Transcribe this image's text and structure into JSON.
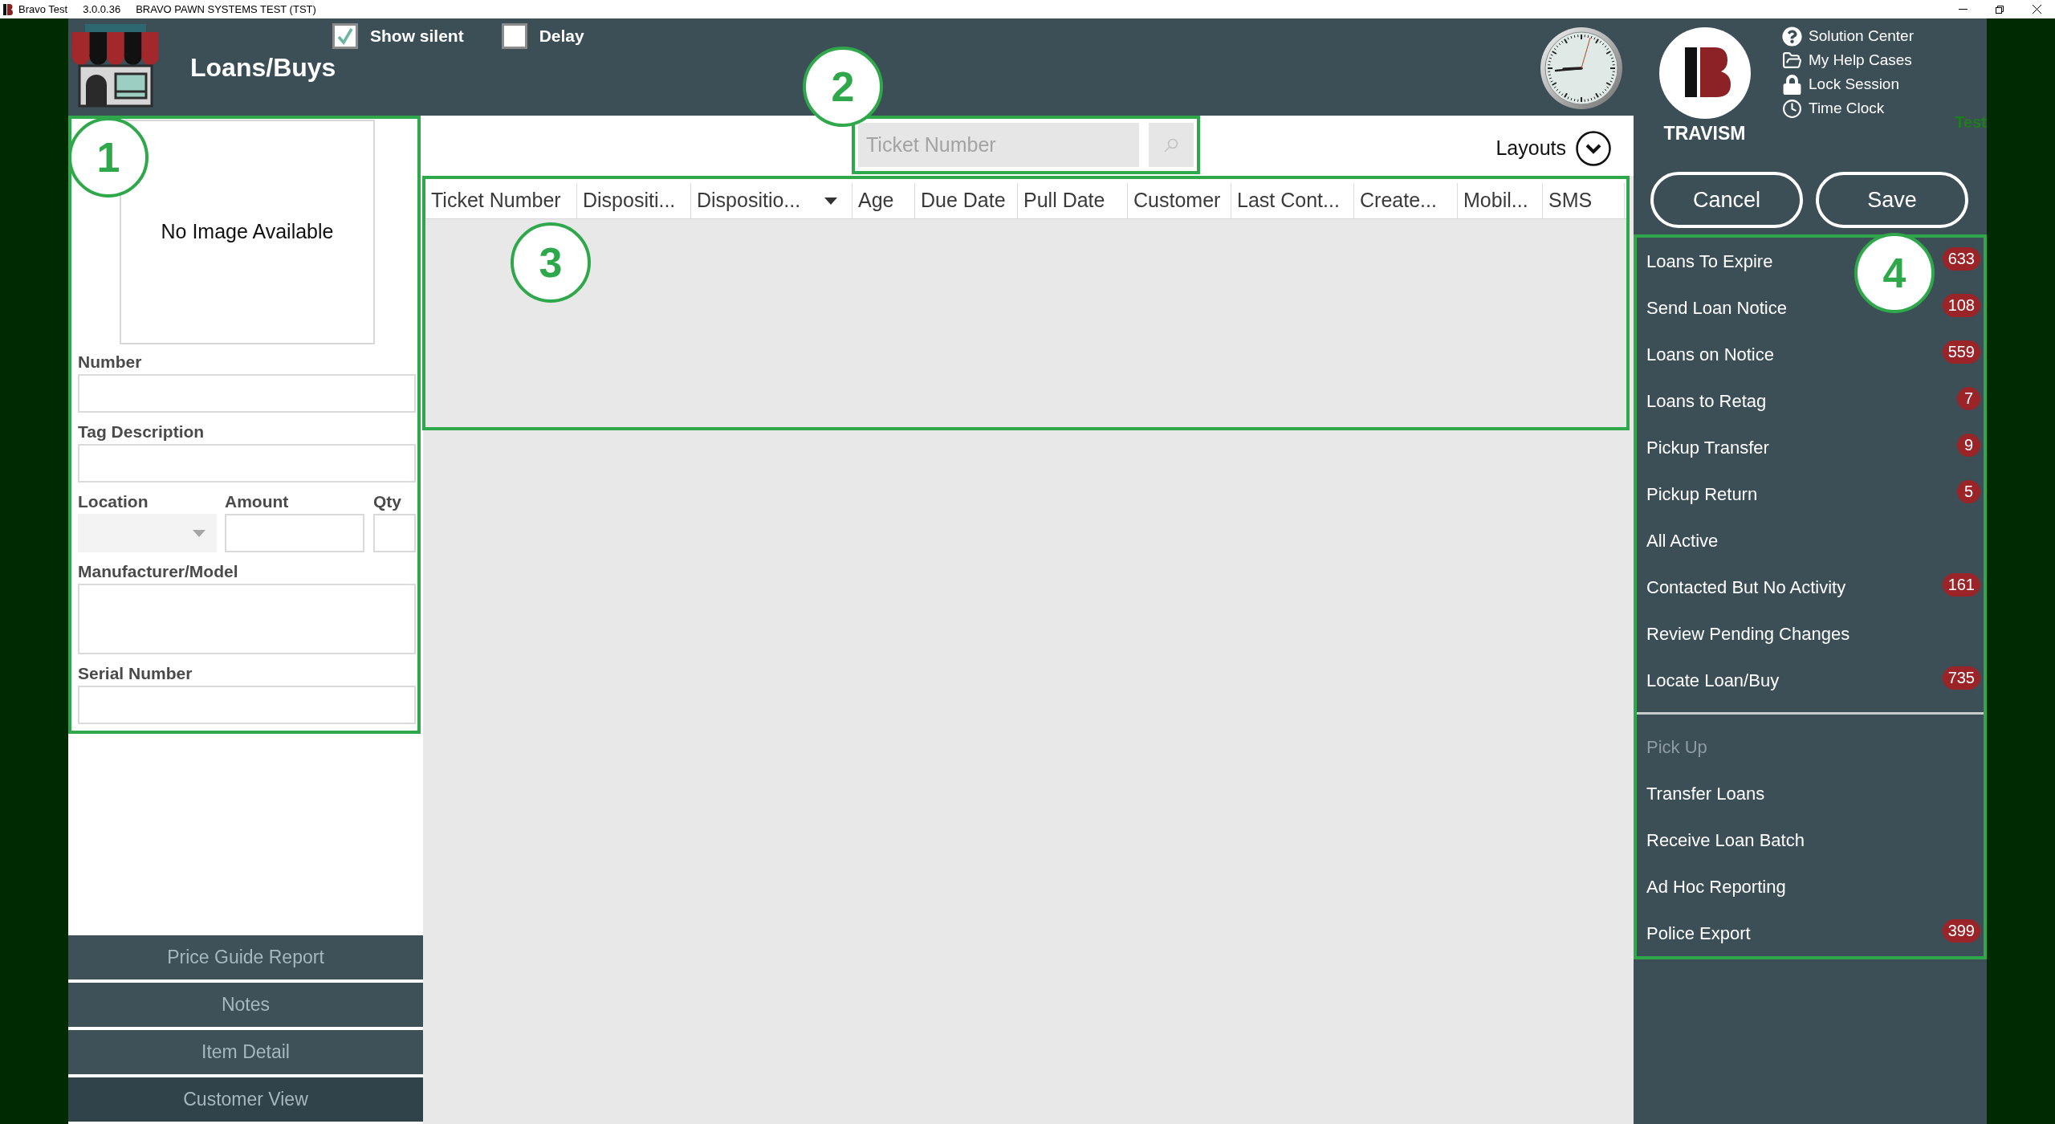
{
  "title_bar": {
    "app_name": "Bravo Test",
    "version": "3.0.0.36",
    "environment": "BRAVO PAWN SYSTEMS TEST (TST)"
  },
  "header": {
    "title": "Loans/Buys",
    "options": [
      {
        "label": "Show silent",
        "checked": true
      },
      {
        "label": "Delay",
        "checked": false
      }
    ]
  },
  "account": {
    "user": "TRAVISM",
    "links": [
      {
        "kind": "help",
        "label": "Solution Center"
      },
      {
        "kind": "folder",
        "label": "My Help Cases"
      },
      {
        "kind": "lock",
        "label": "Lock Session"
      },
      {
        "kind": "clock",
        "label": "Time Clock"
      }
    ],
    "environment_tag": "Test"
  },
  "actions": [
    "Cancel",
    "Save"
  ],
  "details_panel": {
    "callout": "1",
    "image_placeholder": "No Image Available",
    "rows": [
      {
        "fields": [
          {
            "kind": "text",
            "label": "Number"
          }
        ]
      },
      {
        "fields": [
          {
            "kind": "text",
            "label": "Tag Description"
          }
        ]
      },
      {
        "fields": [
          {
            "kind": "dropdown",
            "label": "Location"
          },
          {
            "kind": "text",
            "label": "Amount"
          },
          {
            "kind": "text",
            "label": "Qty"
          }
        ]
      },
      {
        "fields": [
          {
            "kind": "multiline",
            "label": "Manufacturer/Model"
          }
        ]
      },
      {
        "fields": [
          {
            "kind": "text",
            "label": "Serial Number"
          }
        ]
      }
    ]
  },
  "bottom_tabs": [
    {
      "label": "Price Guide Report",
      "selected": false
    },
    {
      "label": "Notes",
      "selected": false
    },
    {
      "label": "Item Detail",
      "selected": false
    },
    {
      "label": "Customer View",
      "selected": true
    }
  ],
  "search": {
    "callout": "2",
    "placeholder": "Ticket Number"
  },
  "layouts": {
    "label": "Layouts"
  },
  "table": {
    "callout": "3",
    "columns": [
      {
        "label": "Ticket Number",
        "sorted": false
      },
      {
        "label": "Dispositi...",
        "sorted": false
      },
      {
        "label": "Dispositio...",
        "sorted": true
      },
      {
        "label": "Age",
        "sorted": false
      },
      {
        "label": "Due Date",
        "sorted": false
      },
      {
        "label": "Pull Date",
        "sorted": false
      },
      {
        "label": "Customer",
        "sorted": false
      },
      {
        "label": "Last Cont...",
        "sorted": false
      },
      {
        "label": "Create...",
        "sorted": false
      },
      {
        "label": "Mobil...",
        "sorted": false
      },
      {
        "label": "SMS",
        "sorted": false
      }
    ]
  },
  "queues": {
    "callout": "4",
    "groups": [
      {
        "items": [
          {
            "label": "Loans To Expire",
            "count": "633",
            "disabled": false
          },
          {
            "label": "Send Loan Notice",
            "count": "108",
            "disabled": false
          },
          {
            "label": "Loans on Notice",
            "count": "559",
            "disabled": false
          },
          {
            "label": "Loans to Retag",
            "count": "7",
            "disabled": false
          },
          {
            "label": "Pickup Transfer",
            "count": "9",
            "disabled": false
          },
          {
            "label": "Pickup Return",
            "count": "5",
            "disabled": false
          },
          {
            "label": "All Active",
            "disabled": false
          },
          {
            "label": "Contacted But No Activity",
            "count": "161",
            "disabled": false
          },
          {
            "label": "Review Pending Changes",
            "disabled": false
          },
          {
            "label": "Locate Loan/Buy",
            "count": "735",
            "disabled": false
          }
        ]
      },
      {
        "items": [
          {
            "label": "Pick Up",
            "disabled": true
          },
          {
            "label": "Transfer Loans",
            "disabled": false
          },
          {
            "label": "Receive Loan Batch",
            "disabled": false
          },
          {
            "label": "Ad Hoc Reporting",
            "disabled": false
          },
          {
            "label": "Police Export",
            "count": "399",
            "disabled": false
          }
        ]
      }
    ]
  }
}
